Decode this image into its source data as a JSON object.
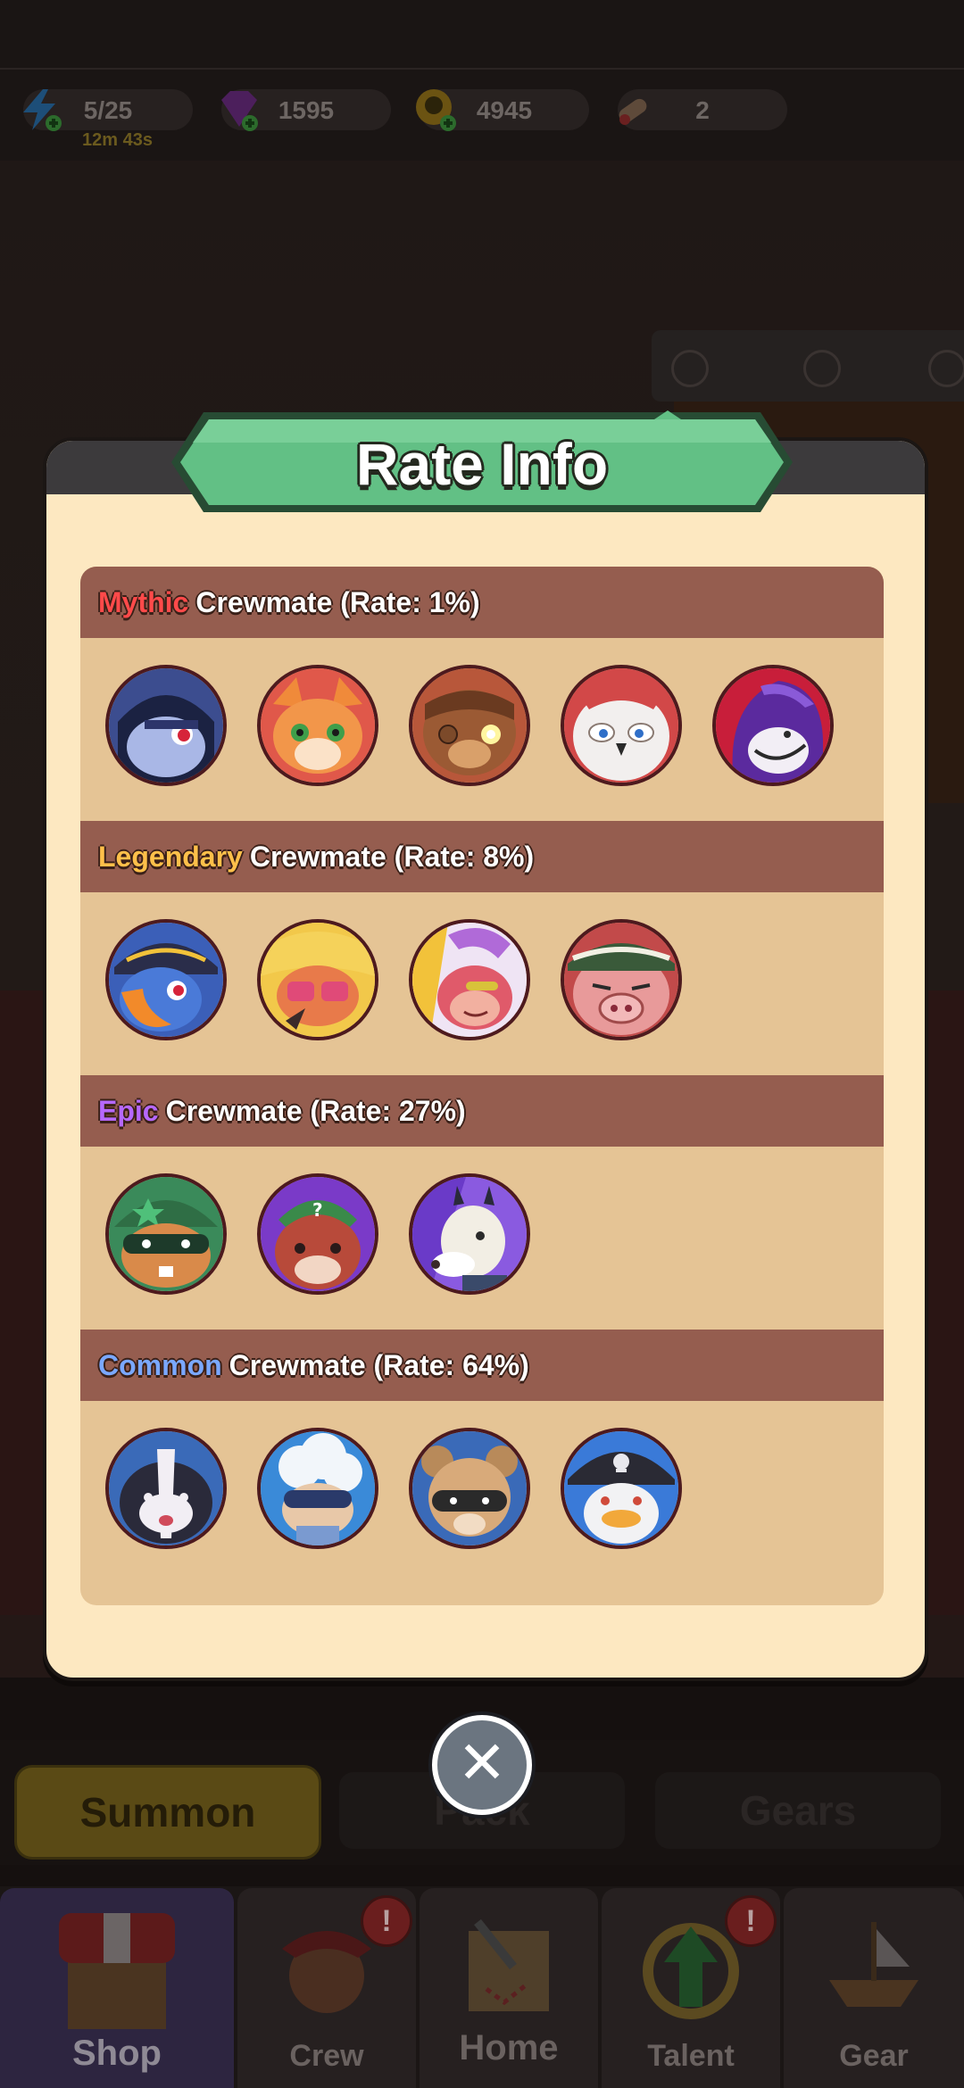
{
  "resources": {
    "energy": {
      "value": "5/25",
      "timer": "12m 43s",
      "icon": "energy-bolt-icon"
    },
    "gems": {
      "value": "1595",
      "icon": "gem-icon"
    },
    "coins": {
      "value": "4945",
      "icon": "skull-coin-icon"
    },
    "scrolls": {
      "value": "2",
      "icon": "scroll-icon"
    }
  },
  "shop_tabs": {
    "summon": "Summon",
    "pack": "Pack",
    "gears": "Gears"
  },
  "nav": {
    "shop": "Shop",
    "crew": "Crew",
    "home": "Home",
    "talent": "Talent",
    "gear": "Gear",
    "crew_badge": "!",
    "talent_badge": "!"
  },
  "modal": {
    "title": "Rate Info",
    "close_icon": "close-x-icon",
    "sections": [
      {
        "rarity": "Mythic",
        "label": "Crewmate (Rate: 1%)",
        "color": "#ff4a4a",
        "crewmates": [
          "masked-rabbit",
          "orange-cat",
          "teddy-bear",
          "snowy-owl",
          "purple-hooded-bird"
        ]
      },
      {
        "rarity": "Legendary",
        "label": "Crewmate (Rate: 8%)",
        "color": "#ffc04a",
        "crewmates": [
          "parrot-pirate",
          "pink-fox",
          "cyber-monkey",
          "green-cap-pig"
        ]
      },
      {
        "rarity": "Epic",
        "label": "Crewmate (Rate: 27%)",
        "color": "#b668ff",
        "crewmates": [
          "masked-hamster",
          "red-panda",
          "white-goat"
        ]
      },
      {
        "rarity": "Common",
        "label": "Crewmate (Rate: 64%)",
        "color": "#7aa8ff",
        "crewmates": [
          "skunk",
          "cloud-hair-kid",
          "bandit-mouse",
          "pirate-duck"
        ]
      }
    ]
  },
  "colors": {
    "banner_green": "#62c085",
    "panel_cream": "#fde8c1",
    "section_brown": "#955d4f",
    "section_tan": "#e5c495"
  }
}
